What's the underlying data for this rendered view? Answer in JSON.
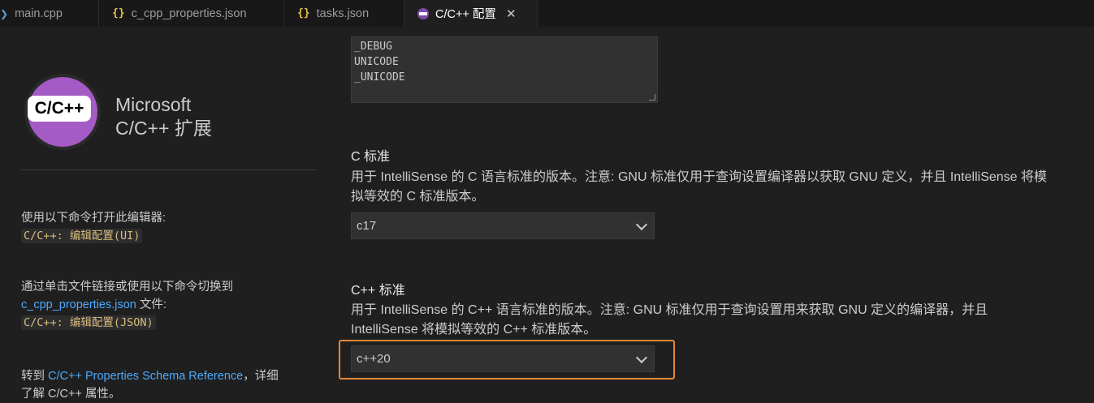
{
  "tabs": [
    {
      "label": "main.cpp",
      "icon": "cpp-file-icon"
    },
    {
      "label": "c_cpp_properties.json",
      "icon": "json-braces-icon"
    },
    {
      "label": "tasks.json",
      "icon": "json-braces-icon"
    },
    {
      "label": "C/C++ 配置",
      "icon": "cpp-extension-icon",
      "active": true
    }
  ],
  "json_icon_glyph": "{}",
  "extension": {
    "logo_text": "C/C++",
    "title_line1": "Microsoft",
    "title_line2": "C/C++ 扩展"
  },
  "sidebar": {
    "open_editor_note": "使用以下命令打开此编辑器:",
    "open_editor_cmd": "C/C++: 编辑配置(UI)",
    "switch_note_1": "通过单击文件链接或使用以下命令切换到",
    "switch_link": "c_cpp_properties.json",
    "switch_note_2": " 文件:",
    "switch_cmd": "C/C++: 编辑配置(JSON)",
    "goto_prefix": "转到 ",
    "goto_link": "C/C++ Properties Schema Reference",
    "goto_suffix": "，详细",
    "goto_line2": "了解 C/C++ 属性。"
  },
  "defines": {
    "values": [
      "_DEBUG",
      "UNICODE",
      "_UNICODE"
    ]
  },
  "c_standard": {
    "title": "C 标准",
    "description_line1": "用于 IntelliSense 的 C 语言标准的版本。注意: GNU 标准仅用于查询设置编译器以获取 GNU 定义，并且 IntelliSense 将模",
    "description_line2": "拟等效的 C 标准版本。",
    "value": "c17"
  },
  "cpp_standard": {
    "title": "C++ 标准",
    "description_line1": "用于 IntelliSense 的 C++ 语言标准的版本。注意: GNU 标准仅用于查询设置用来获取 GNU 定义的编译器，并且",
    "description_line2": "IntelliSense 将模拟等效的 C++ 标准版本。",
    "value": "c++20"
  },
  "colors": {
    "highlight": "#e5883a",
    "link": "#4daafc",
    "logo_purple": "#a45bc5"
  }
}
